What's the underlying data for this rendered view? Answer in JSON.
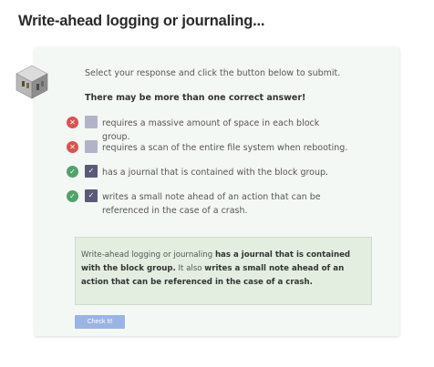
{
  "title": "Write-ahead logging or journaling...",
  "instructions": "Select your response and click the button below to submit.",
  "note": "There may be more than one correct answer!",
  "choices": [
    {
      "result": "wrong",
      "checked": false,
      "text": "requires a massive amount of space in each block group."
    },
    {
      "result": "wrong",
      "checked": false,
      "text": "requires a scan of the entire file system when rebooting."
    },
    {
      "result": "right",
      "checked": true,
      "text": "has a journal that is contained with the block group."
    },
    {
      "result": "right",
      "checked": true,
      "text": "writes a small note ahead of an action that can be referenced in the case of a crash."
    }
  ],
  "feedback": {
    "p1": "Write-ahead logging or journaling ",
    "b1": "has a journal that is contained with the block group.",
    "p2": " It also ",
    "b2": "writes a small note ahead of an action that can be referenced in the case of a crash."
  },
  "submit_label": "Check It!",
  "icons": {
    "wrong": "x-circle-icon",
    "right": "check-circle-icon",
    "checkbox": "checkbox-icon",
    "mascot": "cube-icon"
  },
  "colors": {
    "wrong": "#d9534f",
    "right": "#4fa36a",
    "button": "#9bb4e4",
    "feedback_bg": "#e3eee1"
  }
}
